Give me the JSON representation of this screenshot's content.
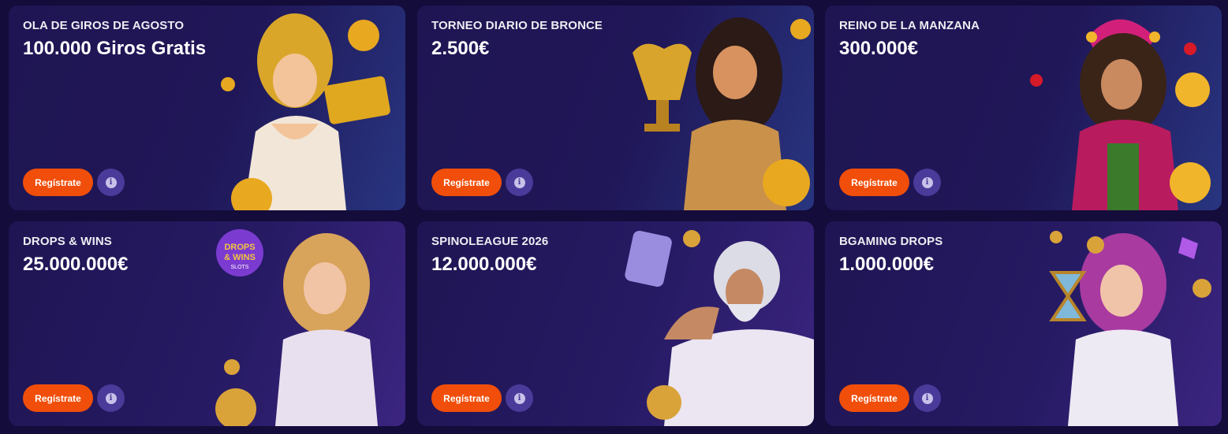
{
  "cards": [
    {
      "subtitle": "OLA DE GIROS DE AGOSTO",
      "prize": "100.000 Giros Gratis",
      "button": "Regístrate",
      "art": "goddess-with-golden-ticket-illustration"
    },
    {
      "subtitle": "TORNEO DIARIO DE BRONCE",
      "prize": "2.500€",
      "button": "Regístrate",
      "art": "woman-with-gold-trophy-illustration"
    },
    {
      "subtitle": "REINO DE LA MANZANA",
      "prize": "300.000€",
      "button": "Regístrate",
      "art": "jester-woman-with-coin-illustration"
    },
    {
      "subtitle": "DROPS & WINS",
      "prize": "25.000.000€",
      "button": "Regístrate",
      "art": "goddess-drops-and-wins-illustration",
      "logo_text": "DROPS & WINS SLOTS"
    },
    {
      "subtitle": "SPINOLEAGUE 2026",
      "prize": "12.000.000€",
      "button": "Regístrate",
      "art": "zeus-with-s-logo-illustration"
    },
    {
      "subtitle": "BGAMING DROPS",
      "prize": "1.000.000€",
      "button": "Regístrate",
      "art": "goddess-with-hourglass-illustration"
    }
  ],
  "info_icon_glyph": "i",
  "colors": {
    "button": "#f04e0a",
    "info": "#4a3a99",
    "card": "#1f1553",
    "page": "#140c3a"
  }
}
